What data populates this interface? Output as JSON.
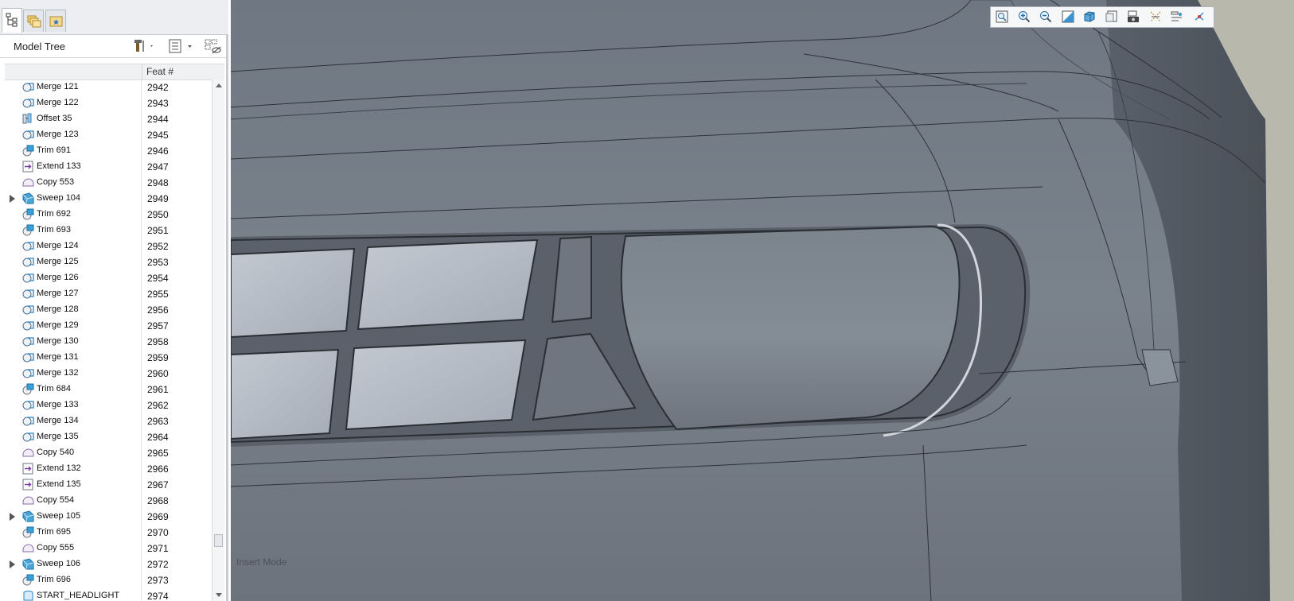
{
  "tabs": [
    {
      "name": "model-tree-tab",
      "icon": "tree-icon",
      "active": true
    },
    {
      "name": "folder-browser-tab",
      "icon": "folders-icon",
      "active": false
    },
    {
      "name": "favorites-tab",
      "icon": "star-folder-icon",
      "active": false
    }
  ],
  "model_tree": {
    "title": "Model Tree",
    "header_icons": [
      "tools-icon",
      "settings-list-icon",
      "show-hide-icon"
    ],
    "column_header": "Feat #",
    "rows": [
      {
        "name": "Merge 121",
        "feat": "2942",
        "icon": "merge",
        "expandable": false
      },
      {
        "name": "Merge 122",
        "feat": "2943",
        "icon": "merge",
        "expandable": false
      },
      {
        "name": "Offset 35",
        "feat": "2944",
        "icon": "offset",
        "expandable": false
      },
      {
        "name": "Merge 123",
        "feat": "2945",
        "icon": "merge",
        "expandable": false
      },
      {
        "name": "Trim 691",
        "feat": "2946",
        "icon": "trim",
        "expandable": false
      },
      {
        "name": "Extend 133",
        "feat": "2947",
        "icon": "extend",
        "expandable": false
      },
      {
        "name": "Copy 553",
        "feat": "2948",
        "icon": "copy",
        "expandable": false
      },
      {
        "name": "Sweep 104",
        "feat": "2949",
        "icon": "sweep",
        "expandable": true
      },
      {
        "name": "Trim 692",
        "feat": "2950",
        "icon": "trim",
        "expandable": false
      },
      {
        "name": "Trim 693",
        "feat": "2951",
        "icon": "trim",
        "expandable": false
      },
      {
        "name": "Merge 124",
        "feat": "2952",
        "icon": "merge",
        "expandable": false
      },
      {
        "name": "Merge 125",
        "feat": "2953",
        "icon": "merge",
        "expandable": false
      },
      {
        "name": "Merge 126",
        "feat": "2954",
        "icon": "merge",
        "expandable": false
      },
      {
        "name": "Merge 127",
        "feat": "2955",
        "icon": "merge",
        "expandable": false
      },
      {
        "name": "Merge 128",
        "feat": "2956",
        "icon": "merge",
        "expandable": false
      },
      {
        "name": "Merge 129",
        "feat": "2957",
        "icon": "merge",
        "expandable": false
      },
      {
        "name": "Merge 130",
        "feat": "2958",
        "icon": "merge",
        "expandable": false
      },
      {
        "name": "Merge 131",
        "feat": "2959",
        "icon": "merge",
        "expandable": false
      },
      {
        "name": "Merge 132",
        "feat": "2960",
        "icon": "merge",
        "expandable": false
      },
      {
        "name": "Trim 684",
        "feat": "2961",
        "icon": "trim",
        "expandable": false
      },
      {
        "name": "Merge 133",
        "feat": "2962",
        "icon": "merge",
        "expandable": false
      },
      {
        "name": "Merge 134",
        "feat": "2963",
        "icon": "merge",
        "expandable": false
      },
      {
        "name": "Merge 135",
        "feat": "2964",
        "icon": "merge",
        "expandable": false
      },
      {
        "name": "Copy 540",
        "feat": "2965",
        "icon": "copy",
        "expandable": false
      },
      {
        "name": "Extend 132",
        "feat": "2966",
        "icon": "extend",
        "expandable": false
      },
      {
        "name": "Extend 135",
        "feat": "2967",
        "icon": "extend",
        "expandable": false
      },
      {
        "name": "Copy 554",
        "feat": "2968",
        "icon": "copy",
        "expandable": false
      },
      {
        "name": "Sweep 105",
        "feat": "2969",
        "icon": "sweep",
        "expandable": true
      },
      {
        "name": "Trim 695",
        "feat": "2970",
        "icon": "trim",
        "expandable": false
      },
      {
        "name": "Copy 555",
        "feat": "2971",
        "icon": "copy",
        "expandable": false
      },
      {
        "name": "Sweep 106",
        "feat": "2972",
        "icon": "sweep",
        "expandable": true
      },
      {
        "name": "Trim 696",
        "feat": "2973",
        "icon": "trim",
        "expandable": false
      },
      {
        "name": "START_HEADLIGHT",
        "feat": "2974",
        "icon": "surface",
        "expandable": false
      }
    ]
  },
  "view_toolbar": [
    {
      "name": "refit-button",
      "icon": "refit-icon"
    },
    {
      "name": "zoom-in-button",
      "icon": "zoom-in-icon"
    },
    {
      "name": "zoom-out-button",
      "icon": "zoom-out-icon"
    },
    {
      "name": "repaint-button",
      "icon": "repaint-icon"
    },
    {
      "name": "display-style-button",
      "icon": "cube-icon"
    },
    {
      "name": "saved-views-button",
      "icon": "saved-views-icon"
    },
    {
      "name": "view-manager-button",
      "icon": "camera-icon"
    },
    {
      "name": "datum-display-button",
      "icon": "datum-icon"
    },
    {
      "name": "annotation-display-button",
      "icon": "annotation-icon"
    },
    {
      "name": "spin-center-button",
      "icon": "spin-center-icon"
    }
  ],
  "viewport": {
    "status_text": "Insert Mode"
  },
  "colors": {
    "model_surface": "#727a85",
    "background_right": "#b9b8ad",
    "glass_highlight": "#b5bcc6",
    "panel_border": "#c8ccd2"
  }
}
